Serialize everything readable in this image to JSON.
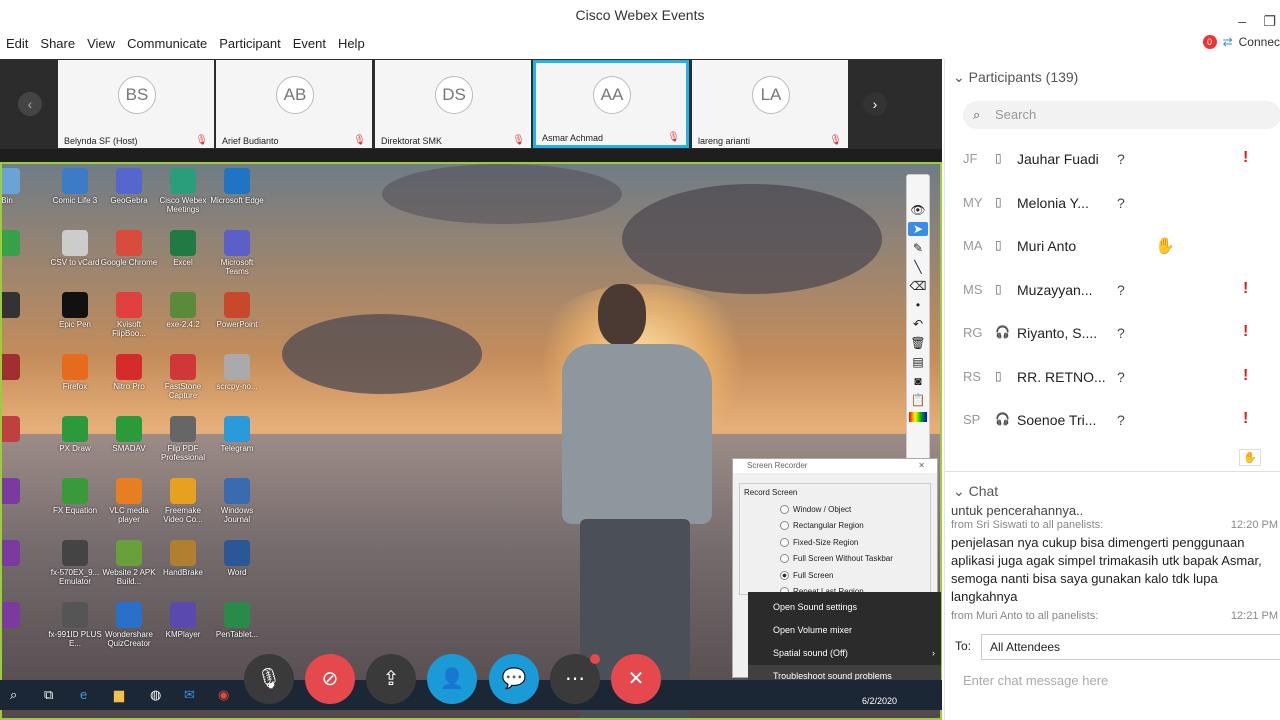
{
  "window": {
    "title": "Cisco Webex Events",
    "minimize": "–",
    "restore": "❐"
  },
  "menu": [
    "Edit",
    "Share",
    "View",
    "Communicate",
    "Participant",
    "Event",
    "Help"
  ],
  "connect": {
    "badge": "0",
    "label": "Connec"
  },
  "strip": {
    "tiles": [
      {
        "initials": "BS",
        "name": "Belynda SF (Host)"
      },
      {
        "initials": "AB",
        "name": "Arief Budianto"
      },
      {
        "initials": "DS",
        "name": "Direktorat SMK"
      },
      {
        "initials": "AA",
        "name": "Asmar Achmad",
        "active": true
      },
      {
        "initials": "LA",
        "name": "lareng arianti"
      }
    ],
    "prev": "‹",
    "next": "›"
  },
  "desktop_icons": [
    {
      "label": "Bin",
      "color": "#6aa3d8"
    },
    {
      "label": "Comic Life 3",
      "color": "#3c7cc6"
    },
    {
      "label": "GeoGebra",
      "color": "#5566cc"
    },
    {
      "label": "Cisco Webex Meetings",
      "color": "#2a9e7a"
    },
    {
      "label": "Microsoft Edge",
      "color": "#1f74c4"
    },
    {
      "label": "",
      "color": "#37a04a"
    },
    {
      "label": "CSV to vCard",
      "color": "#cccccc"
    },
    {
      "label": "Google Chrome",
      "color": "#d94c3b"
    },
    {
      "label": "Excel",
      "color": "#1f7a44"
    },
    {
      "label": "Microsoft Teams",
      "color": "#5b5fc7"
    },
    {
      "label": "",
      "color": "#333"
    },
    {
      "label": "Epic Pen",
      "color": "#111111"
    },
    {
      "label": "Kvisoft FlipBoo...",
      "color": "#e04040"
    },
    {
      "label": "exe-2.4.2",
      "color": "#5a8a3a"
    },
    {
      "label": "PowerPoint",
      "color": "#c9472a"
    },
    {
      "label": "",
      "color": "#a03030"
    },
    {
      "label": "Firefox",
      "color": "#e66b1f"
    },
    {
      "label": "Nitro Pro",
      "color": "#d62b2b"
    },
    {
      "label": "FastStone Capture",
      "color": "#d03838"
    },
    {
      "label": "scrcpy-no...",
      "color": "#aaaaaa"
    },
    {
      "label": "",
      "color": "#c04040"
    },
    {
      "label": "PX Draw",
      "color": "#2c9a3a"
    },
    {
      "label": "SMADAV",
      "color": "#2a9a3a"
    },
    {
      "label": "Flip PDF Professional",
      "color": "#666666"
    },
    {
      "label": "Telegram",
      "color": "#2a9ad8"
    },
    {
      "label": "",
      "color": "#7a3aa0"
    },
    {
      "label": "FX Equation",
      "color": "#3a9a3a"
    },
    {
      "label": "VLC media player",
      "color": "#e67e22"
    },
    {
      "label": "Freemake Video Co...",
      "color": "#e8a020"
    },
    {
      "label": "Windows Journal",
      "color": "#3a6ab0"
    },
    {
      "label": "",
      "color": "#7a3aa0"
    },
    {
      "label": "fx-570EX_9... Emulator",
      "color": "#444444"
    },
    {
      "label": "Website 2 APK Build...",
      "color": "#6aa03a"
    },
    {
      "label": "HandBrake",
      "color": "#b08030"
    },
    {
      "label": "Word",
      "color": "#2b5797"
    },
    {
      "label": "",
      "color": "#7a3aa0"
    },
    {
      "label": "fx-991ID PLUS E...",
      "color": "#555555"
    },
    {
      "label": "Wondershare QuizCreator",
      "color": "#2a70c8"
    },
    {
      "label": "KMPlayer",
      "color": "#5a4ab0"
    },
    {
      "label": "PenTablet...",
      "color": "#2a8a4a"
    }
  ],
  "recorder": {
    "title": "Screen Recorder",
    "group": "Record Screen",
    "options": [
      "Window / Object",
      "Rectangular Region",
      "Fixed-Size Region",
      "Full Screen Without Taskbar",
      "Full Screen",
      "Repeat Last Region"
    ],
    "selected": 4
  },
  "context_menu": [
    "Open Sound settings",
    "Open Volume mixer",
    "Spatial sound (Off)",
    "Troubleshoot sound problems"
  ],
  "taskbar": {
    "date": "6/2/2020"
  },
  "controls": {
    "colors": {
      "mute": "#3a3a3a",
      "video": "#e5484d",
      "share": "#3a3a3a",
      "participants": "#1a9bd7",
      "chat": "#1a9bd7",
      "more": "#3a3a3a",
      "leave": "#e5484d"
    }
  },
  "participants": {
    "header": "Participants (139)",
    "search_placeholder": "Search",
    "list": [
      {
        "initials": "JF",
        "name": "Jauhar Fuadi",
        "q": "?",
        "alert": "!"
      },
      {
        "initials": "MY",
        "name": "Melonia Y...",
        "q": "?",
        "alert": ""
      },
      {
        "initials": "MA",
        "name": "Muri Anto",
        "q": "",
        "alert": "",
        "raise": "✋"
      },
      {
        "initials": "MS",
        "name": "Muzayyan...",
        "q": "?",
        "alert": "!"
      },
      {
        "initials": "RG",
        "name": "Riyanto, S....",
        "q": "?",
        "alert": "!"
      },
      {
        "initials": "RS",
        "name": "RR. RETNO...",
        "q": "?",
        "alert": "!"
      },
      {
        "initials": "SP",
        "name": "Soenoe Tri...",
        "q": "?",
        "alert": "!"
      }
    ]
  },
  "chat": {
    "header": "Chat",
    "partial": "untuk pencerahannya..",
    "messages": [
      {
        "from": "from Sri Siswati to all panelists:",
        "time": "12:20 PM",
        "text": "penjelasan nya cukup bisa dimengerti penggunaan aplikasi juga agak simpel trimakasih utk bapak Asmar, semoga nanti bisa saya gunakan kalo tdk lupa langkahnya"
      },
      {
        "from": "from Muri Anto to all panelists:",
        "time": "12:21 PM",
        "text": ""
      }
    ],
    "to_label": "To:",
    "to_value": "All Attendees",
    "input_placeholder": "Enter chat message here"
  }
}
